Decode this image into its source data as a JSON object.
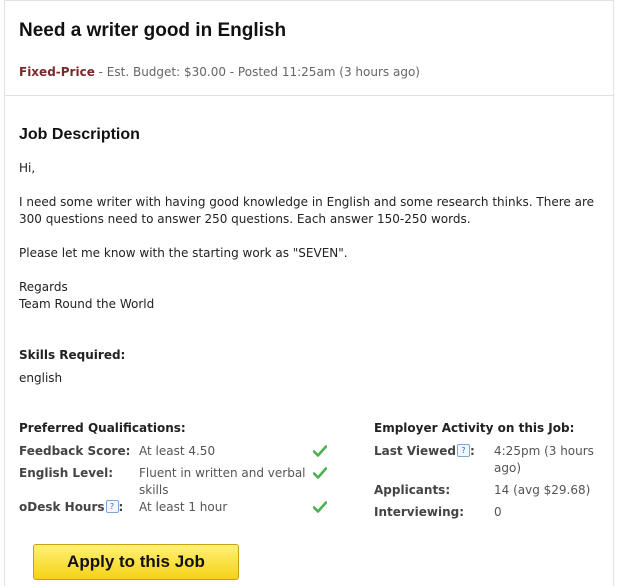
{
  "job": {
    "title": "Need a writer good in English",
    "price_type": "Fixed-Price",
    "meta_rest": " - Est. Budget: $30.00 - Posted 11:25am (3 hours ago)"
  },
  "description": {
    "heading": "Job Description",
    "paragraphs": [
      "Hi,",
      "I need some writer with having good knowledge in English and some research thinks. There are 300 questions need to answer 250 questions. Each answer 150-250 words.",
      "Please let me know with the starting work as \"SEVEN\".",
      "Regards",
      "Team Round the World"
    ]
  },
  "skills": {
    "heading": "Skills Required:",
    "value": "english"
  },
  "preferred": {
    "heading": "Preferred Qualifications:",
    "rows": [
      {
        "label": "Feedback Score:",
        "value": "At least 4.50"
      },
      {
        "label": "English Level:",
        "value": "Fluent in written and verbal skills"
      },
      {
        "label": "oDesk Hours",
        "value": "At least 1 hour"
      }
    ]
  },
  "employer": {
    "heading": "Employer Activity on this Job:",
    "rows": [
      {
        "label": "Last Viewed",
        "value": "4:25pm (3 hours ago)"
      },
      {
        "label": "Applicants:",
        "value": "14 (avg $29.68)"
      },
      {
        "label": "Interviewing:",
        "value": "0"
      }
    ]
  },
  "help_glyph": "?",
  "apply_label": "Apply to this Job",
  "colors": {
    "check": "#4caf50",
    "fixed_price": "#7a2a2a",
    "apply_bg": "#f5d215"
  }
}
